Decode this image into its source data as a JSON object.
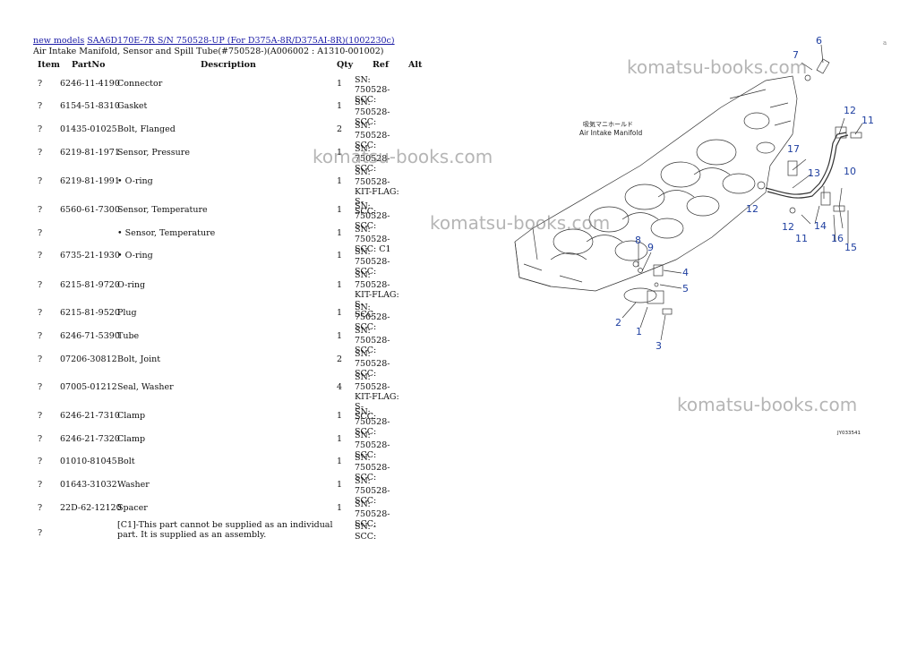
{
  "breadcrumb": {
    "link1": "new models",
    "link2": "SAA6D170E-7R S/N 750528-UP (For D375A-8R/D375AI-8R)(1002230c)"
  },
  "subtitle": "Air Intake Manifold, Sensor and Spill Tube(#750528-)(A006002 : A1310-001002)",
  "table": {
    "headers": {
      "item": "Item",
      "partno": "PartNo",
      "description": "Description",
      "qty": "Qty",
      "ref": "Ref",
      "alt": "Alt"
    },
    "rows": [
      {
        "item": "?",
        "partno": "6246-11-4190",
        "description": "Connector",
        "qty": "1",
        "ref": "SN: 750528-\nSCC:"
      },
      {
        "item": "?",
        "partno": "6154-51-8310",
        "description": "Gasket",
        "qty": "1",
        "ref": "SN: 750528-\nSCC:"
      },
      {
        "item": "?",
        "partno": "01435-01025",
        "description": "Bolt, Flanged",
        "qty": "2",
        "ref": "SN: 750528-\nSCC:"
      },
      {
        "item": "?",
        "partno": "6219-81-1971",
        "description": "Sensor, Pressure",
        "qty": "1",
        "ref": "SN: 750528-\nSCC:"
      },
      {
        "item": "?",
        "partno": "6219-81-1991",
        "description": "• O-ring",
        "qty": "1",
        "ref": "SN: 750528-\nKIT-FLAG: S-\nSCC:"
      },
      {
        "item": "?",
        "partno": "6560-61-7300",
        "description": "Sensor, Temperature",
        "qty": "1",
        "ref": "SN: 750528-\nSCC:"
      },
      {
        "item": "?",
        "partno": "",
        "description": "• Sensor, Temperature",
        "qty": "1",
        "ref": "SN: 750528-\nSCC: C1"
      },
      {
        "item": "?",
        "partno": "6735-21-1930",
        "description": "• O-ring",
        "qty": "1",
        "ref": "SN: 750528-\nSCC:"
      },
      {
        "item": "?",
        "partno": "6215-81-9720",
        "description": "O-ring",
        "qty": "1",
        "ref": "SN: 750528-\nKIT-FLAG: S-\nSCC:"
      },
      {
        "item": "?",
        "partno": "6215-81-9520",
        "description": "Plug",
        "qty": "1",
        "ref": "SN: 750528-\nSCC:"
      },
      {
        "item": "?",
        "partno": "6246-71-5390",
        "description": "Tube",
        "qty": "1",
        "ref": "SN: 750528-\nSCC:"
      },
      {
        "item": "?",
        "partno": "07206-30812",
        "description": "Bolt, Joint",
        "qty": "2",
        "ref": "SN: 750528-\nSCC:"
      },
      {
        "item": "?",
        "partno": "07005-01212",
        "description": "Seal, Washer",
        "qty": "4",
        "ref": "SN: 750528-\nKIT-FLAG: S-\nSCC:"
      },
      {
        "item": "?",
        "partno": "6246-21-7310",
        "description": "Clamp",
        "qty": "1",
        "ref": "SN: 750528-\nSCC:"
      },
      {
        "item": "?",
        "partno": "6246-21-7320",
        "description": "Clamp",
        "qty": "1",
        "ref": "SN: 750528-\nSCC:"
      },
      {
        "item": "?",
        "partno": "01010-81045",
        "description": "Bolt",
        "qty": "1",
        "ref": "SN: 750528-\nSCC:"
      },
      {
        "item": "?",
        "partno": "01643-31032",
        "description": "Washer",
        "qty": "1",
        "ref": "SN: 750528-\nSCC:"
      },
      {
        "item": "?",
        "partno": "22D-62-12120",
        "description": "Spacer",
        "qty": "1",
        "ref": "SN: 750528-\nSCC:"
      },
      {
        "item": "?",
        "partno": "",
        "description": "[C1]-This part cannot be supplied as an individual part. It is supplied as an assembly.",
        "qty": "",
        "ref": "SN: -\nSCC:"
      }
    ]
  },
  "figure": {
    "label_jp": "吸気マニホールド",
    "label_en": "Air Intake Manifold",
    "callouts": [
      "1",
      "2",
      "3",
      "4",
      "5",
      "6",
      "7",
      "8",
      "9",
      "10",
      "11",
      "12",
      "12",
      "13",
      "14",
      "15",
      "16",
      "17",
      "11",
      "12"
    ],
    "figure_code": "JY033541",
    "callout_color": "#1f3fa0"
  },
  "watermarks": [
    "komatsu-books.com",
    "komatsu-books.com",
    "komatsu-books.com",
    "komatsu-books.com"
  ],
  "corner_mark": "a"
}
